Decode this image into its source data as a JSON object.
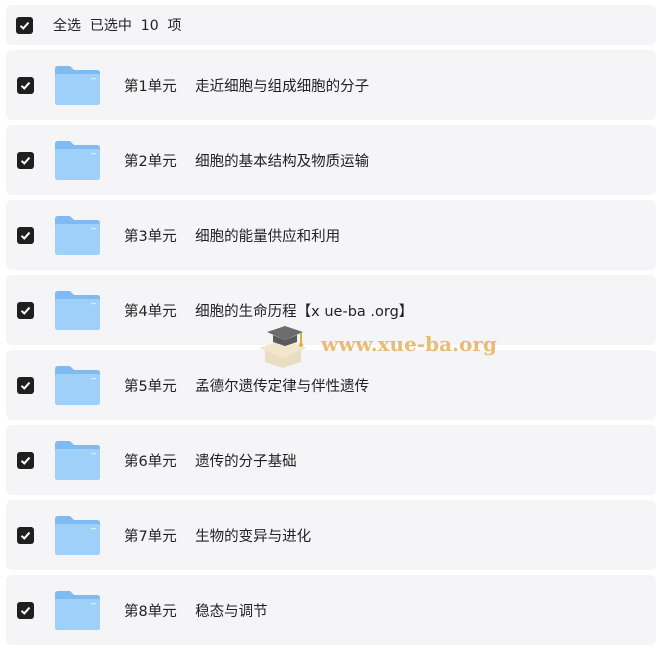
{
  "header": {
    "select_all_label": "全选  已选中  10  项"
  },
  "items": [
    {
      "label": "第1单元    走近细胞与组成细胞的分子"
    },
    {
      "label": "第2单元    细胞的基本结构及物质运输"
    },
    {
      "label": "第3单元    细胞的能量供应和利用"
    },
    {
      "label": "第4单元    细胞的生命历程【x ue-ba .org】"
    },
    {
      "label": "第5单元    孟德尔遗传定律与伴性遗传"
    },
    {
      "label": "第6单元    遗传的分子基础"
    },
    {
      "label": "第7单元    生物的变异与进化"
    },
    {
      "label": "第8单元    稳态与调节"
    }
  ],
  "watermark": {
    "text": "www.xue-ba.org"
  },
  "colors": {
    "row_bg": "#f5f5f7",
    "checkbox": "#1f1f1f",
    "folder_back": "#7fbaf0",
    "folder_front": "#9fd0fa"
  }
}
